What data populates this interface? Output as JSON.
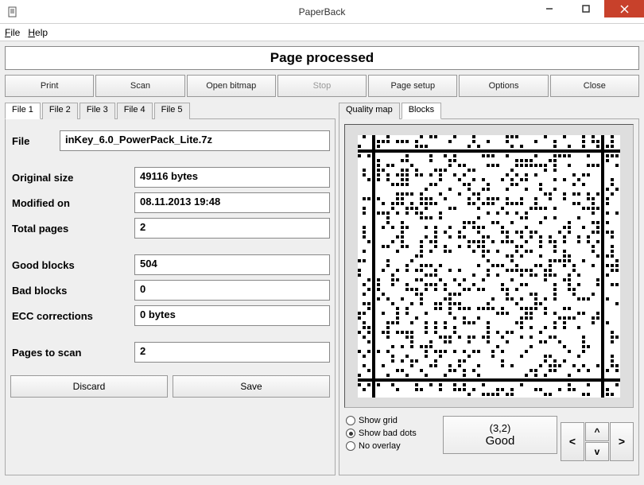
{
  "window": {
    "title": "PaperBack"
  },
  "menu": {
    "file": "File",
    "help": "Help"
  },
  "banner": "Page processed",
  "toolbar": {
    "print": "Print",
    "scan": "Scan",
    "open_bitmap": "Open bitmap",
    "stop": "Stop",
    "page_setup": "Page setup",
    "options": "Options",
    "close": "Close"
  },
  "left_tabs": {
    "file1": "File 1",
    "file2": "File 2",
    "file3": "File 3",
    "file4": "File 4",
    "file5": "File 5"
  },
  "right_tabs": {
    "quality_map": "Quality map",
    "blocks": "Blocks"
  },
  "form": {
    "file_label": "File",
    "file_value": "inKey_6.0_PowerPack_Lite.7z",
    "original_size_label": "Original size",
    "original_size_value": "49116 bytes",
    "modified_on_label": "Modified on",
    "modified_on_value": "08.11.2013 19:48",
    "total_pages_label": "Total pages",
    "total_pages_value": "2",
    "good_blocks_label": "Good blocks",
    "good_blocks_value": "504",
    "bad_blocks_label": "Bad blocks",
    "bad_blocks_value": "0",
    "ecc_label": "ECC corrections",
    "ecc_value": "0 bytes",
    "pages_to_scan_label": "Pages to scan",
    "pages_to_scan_value": "2"
  },
  "actions": {
    "discard": "Discard",
    "save": "Save"
  },
  "overlay": {
    "show_grid": "Show grid",
    "show_bad_dots": "Show bad dots",
    "no_overlay": "No overlay"
  },
  "status": {
    "coord": "(3,2)",
    "state": "Good"
  },
  "nav": {
    "up": "^",
    "down": "v",
    "left": "<",
    "right": ">"
  }
}
